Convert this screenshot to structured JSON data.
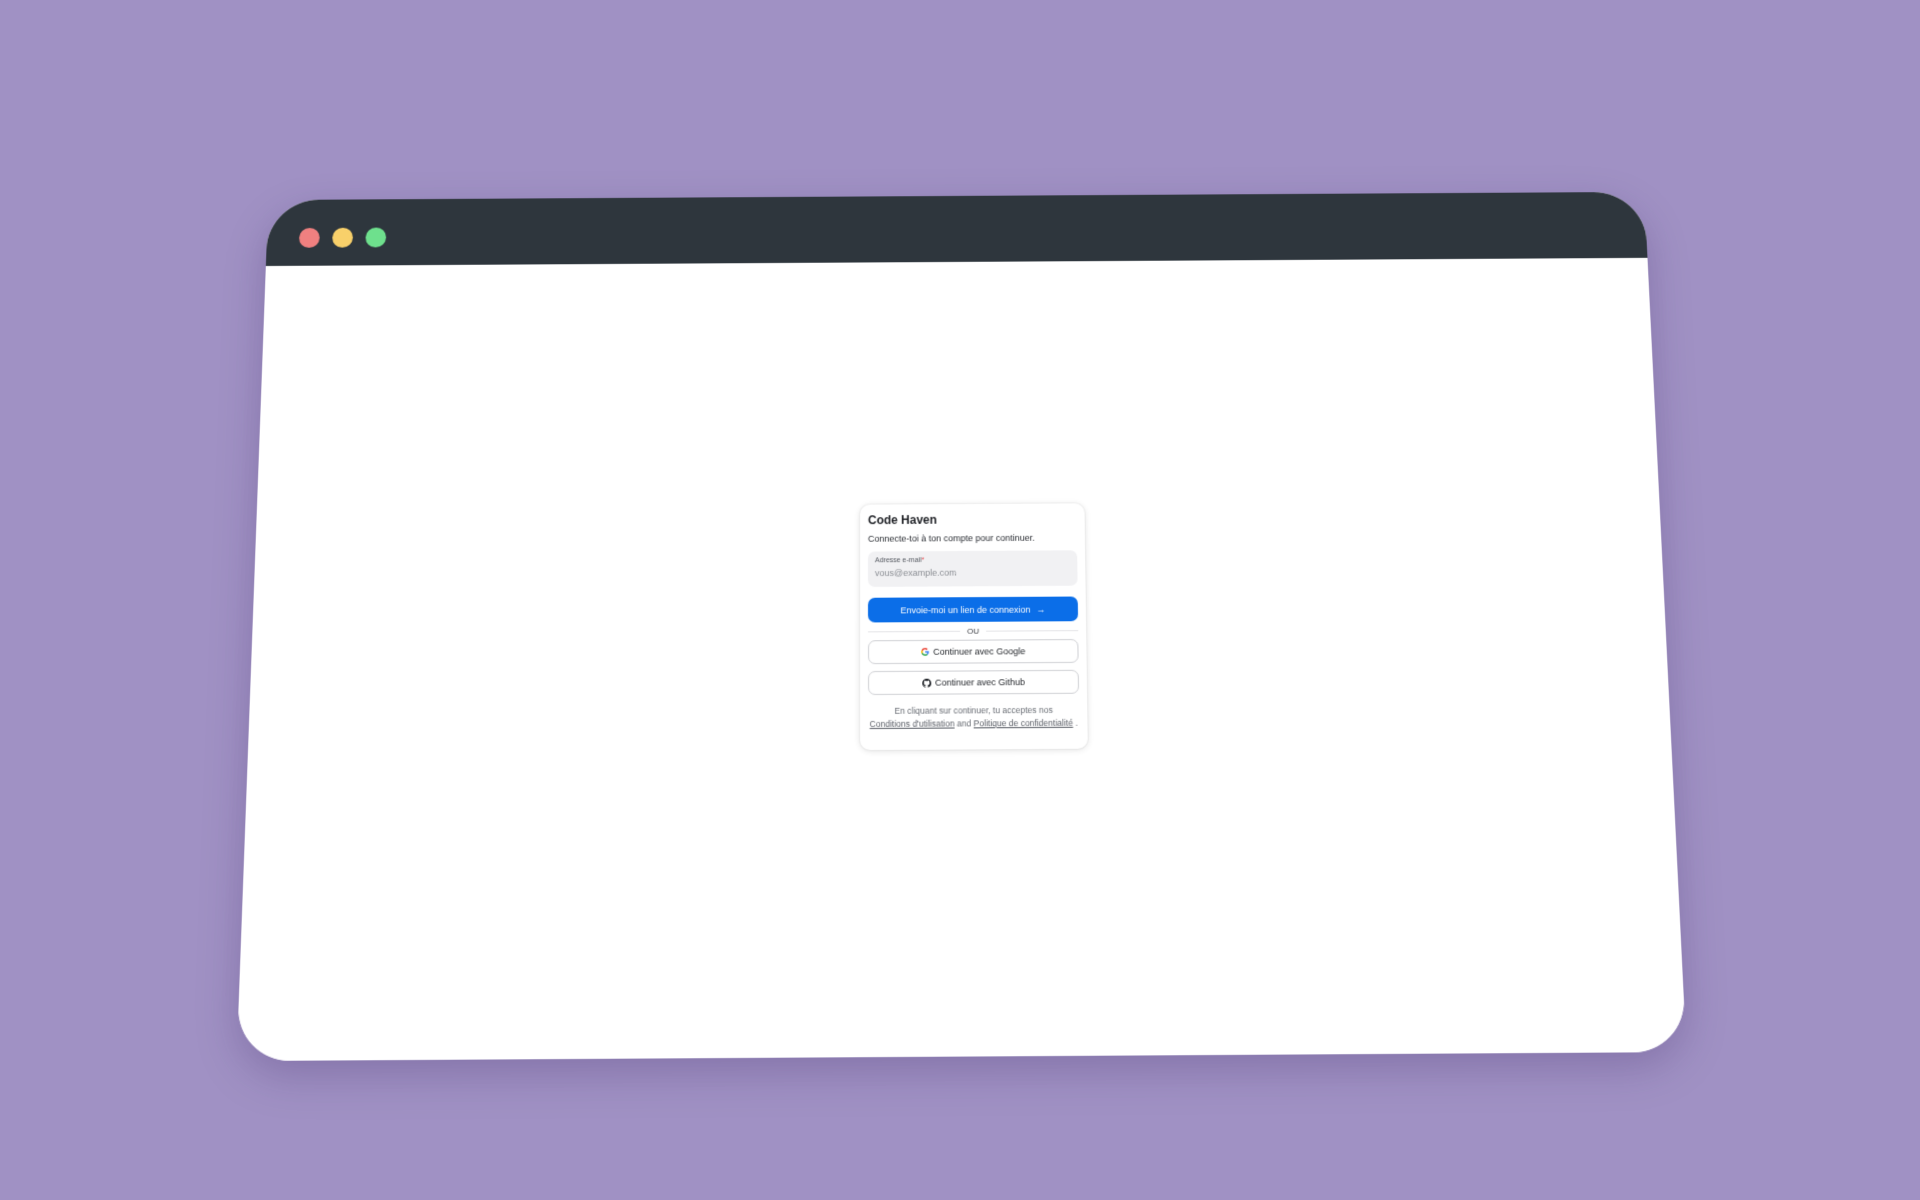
{
  "window": {
    "controls": [
      "close",
      "minimize",
      "maximize"
    ]
  },
  "login": {
    "title": "Code Haven",
    "subtitle": "Connecte-toi à ton compte pour continuer.",
    "email_label": "Adresse e-mail",
    "required_mark": "*",
    "email_placeholder": "vous@example.com",
    "email_value": "",
    "magic_link_button": "Envoie-moi un lien de connexion",
    "divider_text": "OU",
    "google_button": "Continuer avec Google",
    "github_button": "Continuer avec Github",
    "legal_prefix": "En cliquant sur continuer, tu acceptes nos",
    "terms_link": "Conditions d'utilisation",
    "legal_and": "and",
    "privacy_link": "Politique de confidentialité",
    "legal_suffix": "."
  },
  "icons": {
    "magic_link_button": "arrow-right-icon",
    "google_button": "google-icon",
    "github_button": "github-icon"
  },
  "colors": {
    "background": "#a091c4",
    "titlebar": "#2e363d",
    "primary": "#0b6ee8",
    "close": "#f08080",
    "minimize": "#f8d06a",
    "maximize": "#6ee08d"
  }
}
